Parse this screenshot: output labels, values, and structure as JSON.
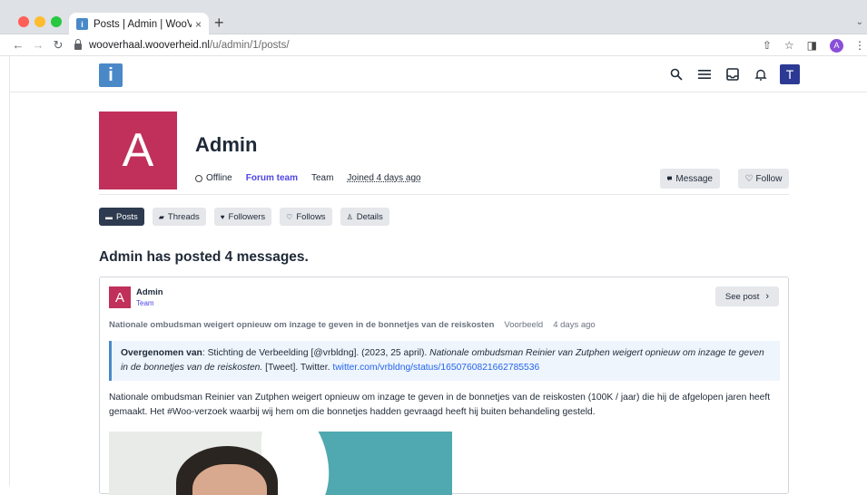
{
  "browser": {
    "tab_title": "Posts | Admin | WooVerhaal",
    "favicon_letter": "i",
    "tab_close": "×",
    "new_tab": "+",
    "url_host": "wooverhaal.wooverheid.nl",
    "url_path": "/u/admin/1/posts/",
    "profile_letter": "A"
  },
  "site": {
    "logo_letter": "i",
    "user_avatar_letter": "T"
  },
  "profile": {
    "avatar_letter": "A",
    "name": "Admin",
    "status": "Offline",
    "group": "Forum team",
    "role": "Team",
    "joined": "Joined 4 days ago",
    "message_label": "Message",
    "follow_label": "Follow"
  },
  "tabs": [
    {
      "label": "Posts",
      "icon": "speech-bubble-icon",
      "active": true
    },
    {
      "label": "Threads",
      "icon": "threads-icon",
      "active": false
    },
    {
      "label": "Followers",
      "icon": "heart-filled-icon",
      "active": false
    },
    {
      "label": "Follows",
      "icon": "heart-outline-icon",
      "active": false
    },
    {
      "label": "Details",
      "icon": "person-icon",
      "active": false
    }
  ],
  "posts_heading": "Admin has posted 4 messages.",
  "post": {
    "avatar_letter": "A",
    "author": "Admin",
    "role": "Team",
    "see_post_label": "See post",
    "thread_title": "Nationale ombudsman weigert opnieuw om inzage te geven in de bonnetjes van de reiskosten",
    "category": "Voorbeeld",
    "time": "4 days ago",
    "quote": {
      "label": "Overgenomen van",
      "source": ": Stichting de Verbeelding [@vrbldng]. (2023, 25 april). ",
      "title_italic": "Nationale ombudsman Reinier van Zutphen weigert opnieuw om inzage te geven in de bonnetjes van de reiskosten.",
      "suffix": " [Tweet]. Twitter. ",
      "link": "twitter.com/vrbldng/status/1650760821662785536"
    },
    "body": "Nationale ombudsman Reinier van Zutphen weigert opnieuw om inzage te geven in de bonnetjes van de reiskosten (100K / jaar) die hij de afgelopen jaren heeft gemaakt. Het #Woo-verzoek waarbij wij hem om die bonnetjes hadden gevraagd heeft hij buiten behandeling gesteld."
  },
  "colors": {
    "avatar_bg": "#c0305a",
    "accent": "#4f46e5",
    "logo_bg": "#4a89c8",
    "active_tab_bg": "#2d3a4f",
    "user_avatar_bg": "#2c3a95"
  }
}
